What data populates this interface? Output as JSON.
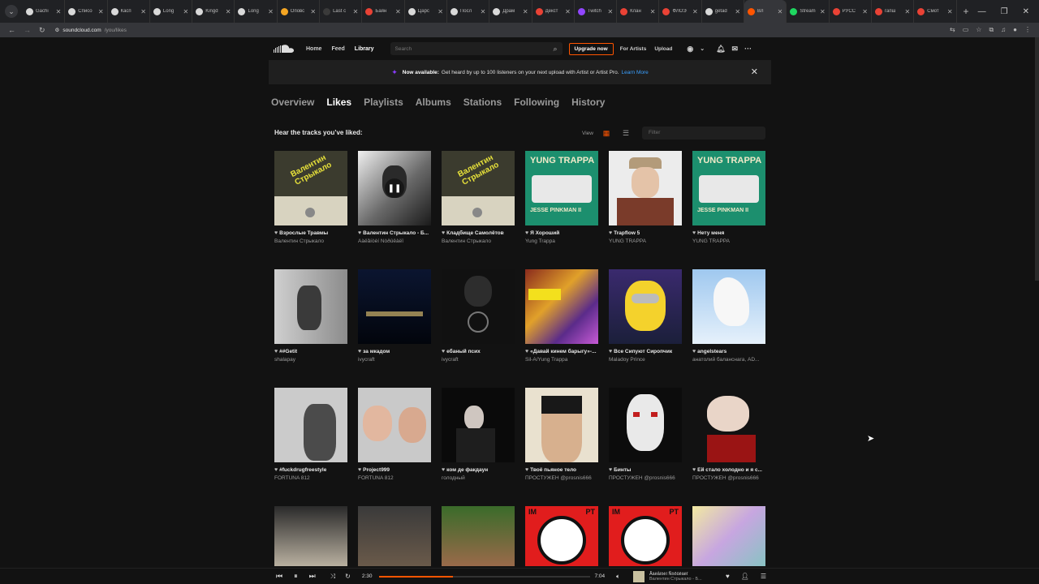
{
  "browser": {
    "tabs": [
      {
        "title": "Gachi",
        "color": "#d9d9d9"
      },
      {
        "title": "Списо",
        "color": "#d9d9d9"
      },
      {
        "title": "Касп",
        "color": "#d9d9d9"
      },
      {
        "title": "Long",
        "color": "#d9d9d9"
      },
      {
        "title": "Kingd",
        "color": "#d9d9d9"
      },
      {
        "title": "Long",
        "color": "#d9d9d9"
      },
      {
        "title": "Оповс",
        "color": "#f5a623"
      },
      {
        "title": "Last c",
        "color": "#3a3a3a"
      },
      {
        "title": "Баян",
        "color": "#e94235"
      },
      {
        "title": "Царс",
        "color": "#d9d9d9"
      },
      {
        "title": "Посл",
        "color": "#d9d9d9"
      },
      {
        "title": "Драм",
        "color": "#d9d9d9"
      },
      {
        "title": "Декст",
        "color": "#e94235"
      },
      {
        "title": "Twitch",
        "color": "#9146ff"
      },
      {
        "title": "Клан",
        "color": "#e94235"
      },
      {
        "title": "ФЛОЭ",
        "color": "#e94235"
      },
      {
        "title": "getad",
        "color": "#d9d9d9"
      },
      {
        "title": "Вл",
        "color": "#ff5500",
        "active": true
      },
      {
        "title": "Stream",
        "color": "#1ed760"
      },
      {
        "title": "РУСС",
        "color": "#e94235"
      },
      {
        "title": "гапш",
        "color": "#e94235"
      },
      {
        "title": "Смот",
        "color": "#e94235"
      }
    ],
    "new_tab": "+",
    "url_host": "soundcloud.com",
    "url_path": "/you/likes"
  },
  "nav": {
    "home": "Home",
    "feed": "Feed",
    "library": "Library",
    "search_placeholder": "Search",
    "upgrade": "Upgrade now",
    "for_artists": "For Artists",
    "upload": "Upload",
    "more": "···"
  },
  "banner": {
    "bold": "Now available:",
    "text": "Get heard by up to 100 listeners on your next upload with Artist or Artist Pro.",
    "link": "Learn More"
  },
  "library_tabs": [
    "Overview",
    "Likes",
    "Playlists",
    "Albums",
    "Stations",
    "Following",
    "History"
  ],
  "subhead": "Hear the tracks you’ve liked:",
  "view_label": "View",
  "filter_placeholder": "Filter",
  "tracks": [
    {
      "title": "Взрослые Травмы",
      "artist": "Валентин Стрыкало"
    },
    {
      "title": "Валентин Стрыкало - Б...",
      "artist": "Ãàëåíòèí Ñòðûêàëî"
    },
    {
      "title": "Кладбище Самолётов",
      "artist": "Валентин Стрыкало"
    },
    {
      "title": "Я Хороший",
      "artist": "Yung Trappa"
    },
    {
      "title": "Trapflow 5",
      "artist": "YUNG TRAPPA"
    },
    {
      "title": "Нету меня",
      "artist": "YUNG TRAPPA"
    },
    {
      "title": "##Getit",
      "artist": "shalapay"
    },
    {
      "title": "за мкадом",
      "artist": "ivycraft"
    },
    {
      "title": "ебаный псих",
      "artist": "ivycraft"
    },
    {
      "title": "«Давай кинем барыгу»-...",
      "artist": "Sil-A/Yung Trappa"
    },
    {
      "title": "Все Сипуют Сиропчик",
      "artist": "Maladoy Prince"
    },
    {
      "title": "angelstears",
      "artist": "анатолий баланснага, AD..."
    },
    {
      "title": "#fuckdrugfreestyle",
      "artist": "FORTUNA 812"
    },
    {
      "title": "Project999",
      "artist": "FORTUNA 812"
    },
    {
      "title": "ком де факдаун",
      "artist": "голодный"
    },
    {
      "title": "Твоё пьяное тело",
      "artist": "ПРОСТУЖЕН @prosnis666"
    },
    {
      "title": "Бинты",
      "artist": "ПРОСТУЖЕН @prosnis666"
    },
    {
      "title": "Ей стало холодно и я с...",
      "artist": "ПРОСТУЖЕН @prosnis666"
    },
    {
      "title": "",
      "artist": ""
    },
    {
      "title": "",
      "artist": ""
    },
    {
      "title": "",
      "artist": ""
    },
    {
      "title": "",
      "artist": ""
    },
    {
      "title": "",
      "artist": ""
    },
    {
      "title": "",
      "artist": ""
    }
  ],
  "art_text": {
    "valentin": "Валентин Стрыкало",
    "yung_trappa": "YUNG TRAPPA",
    "jesse": "JESSE PINKMAN II",
    "im": "IM",
    "pt": "PT"
  },
  "player": {
    "elapsed": "2:30",
    "duration": "7:04",
    "title": "Ãàëåíòèí Ñòðûêàëî",
    "artist": "Валентин Стрыкало - Б...",
    "progress_pct": 35
  }
}
